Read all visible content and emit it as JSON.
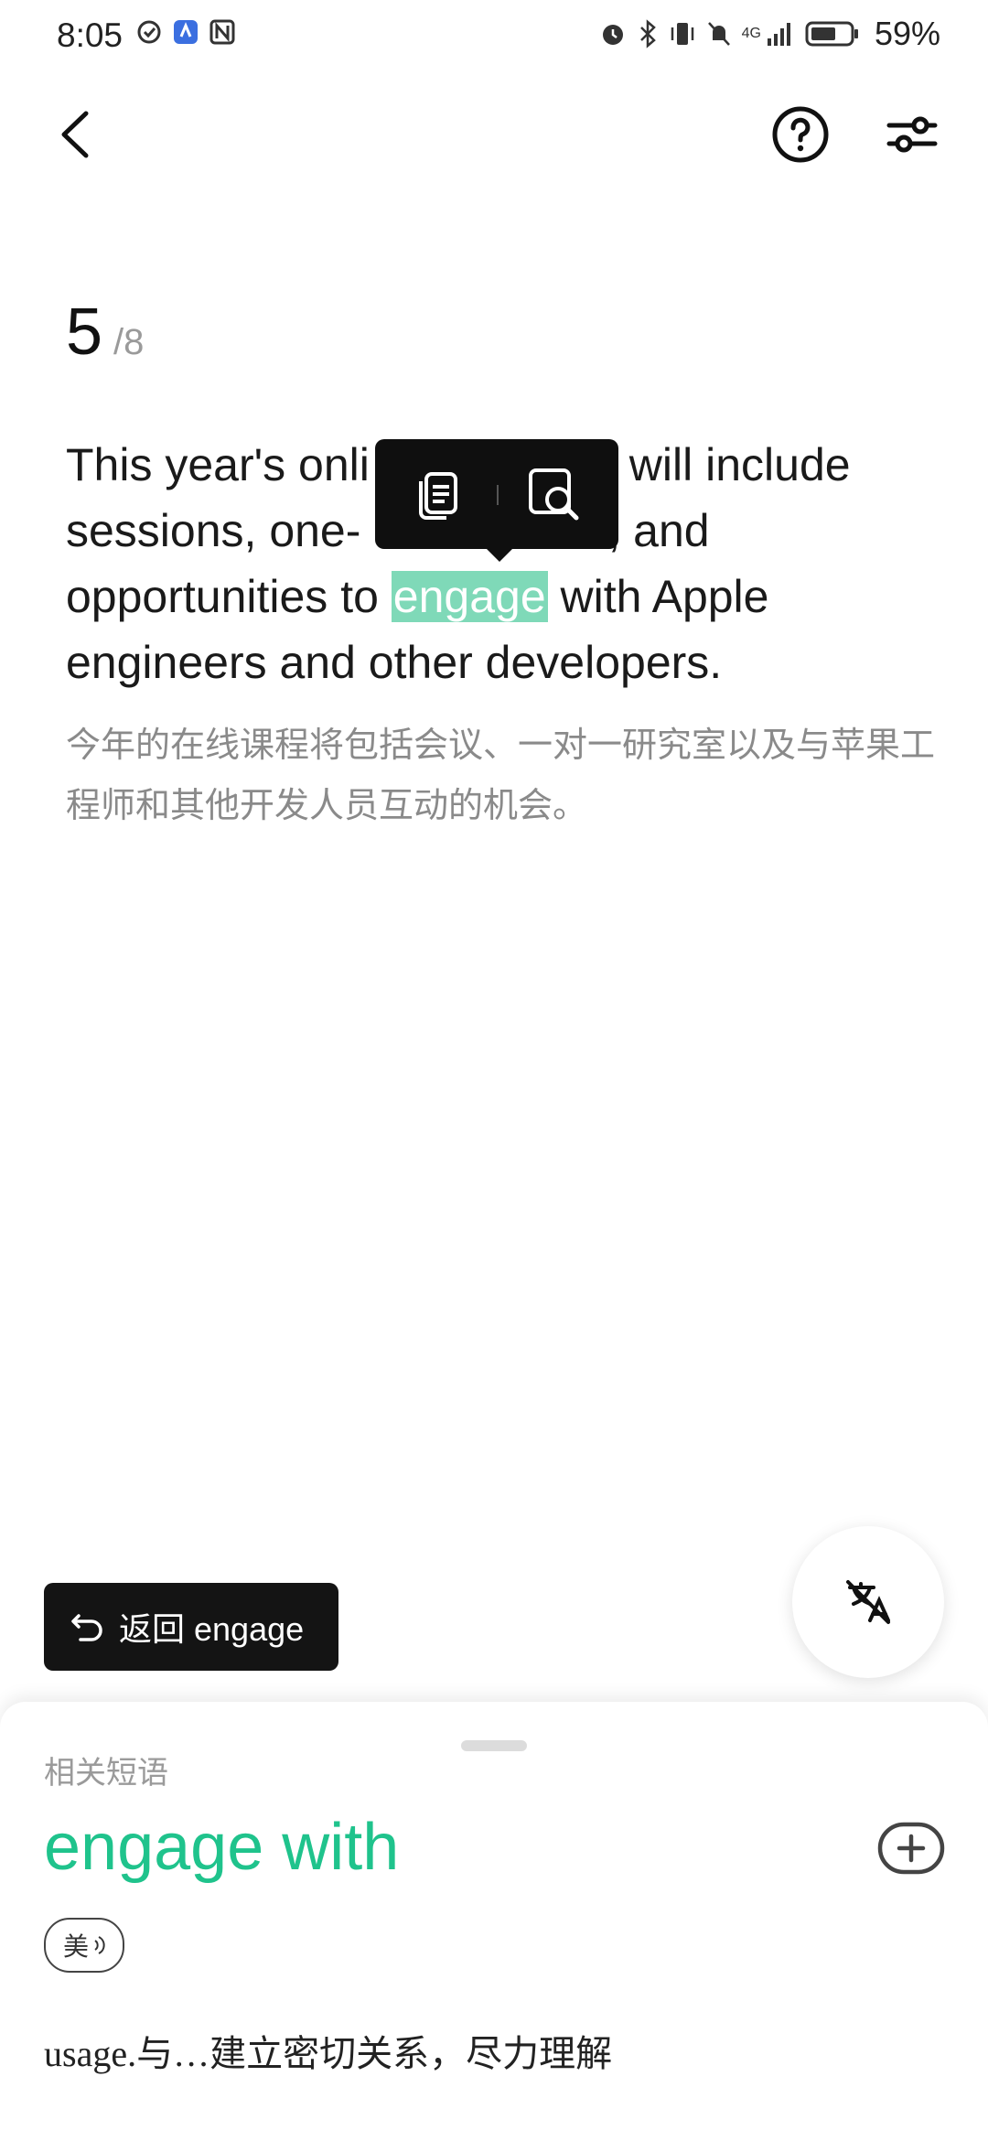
{
  "status_bar": {
    "time": "8:05",
    "network_label": "4G",
    "battery_percent": "59%",
    "left_icons": [
      "alarm-check-icon",
      "app-badge-icon",
      "nfc-icon"
    ],
    "right_icons": [
      "alarm-icon",
      "bluetooth-icon",
      "vibrate-icon",
      "mute-icon",
      "signal-icon",
      "battery-icon"
    ]
  },
  "header": {
    "back_icon": "chevron-left-icon",
    "help_icon": "question-circle-icon",
    "settings_icon": "sliders-icon"
  },
  "counter": {
    "current": "5",
    "total": "/8"
  },
  "sentence": {
    "line1_before": "This year's onli",
    "line1_after": " will include",
    "line2_before": "sessions, one-",
    "line2_after": ", and",
    "line3_before": "opportunities to ",
    "highlighted_word": "engage",
    "line3_after": " with Apple",
    "line4": "engineers and other developers.",
    "translation": "今年的在线课程将包括会议、一对一研究室以及与苹果工程师和其他开发人员互动的机会。"
  },
  "selection_toolbar": {
    "actions": [
      "copy-icon",
      "lookup-search-icon"
    ]
  },
  "return_chip": {
    "label": "返回 engage",
    "icon": "undo-icon"
  },
  "fab": {
    "icon": "hide-translation-icon"
  },
  "sheet": {
    "section_label": "相关短语",
    "phrase": "engage with",
    "pronunciation_label": "美",
    "definition": "usage.与…建立密切关系，尽力理解"
  },
  "colors": {
    "accent": "#1fc38c",
    "highlight": "#7fd9b8",
    "dark": "#0f0f0f"
  }
}
